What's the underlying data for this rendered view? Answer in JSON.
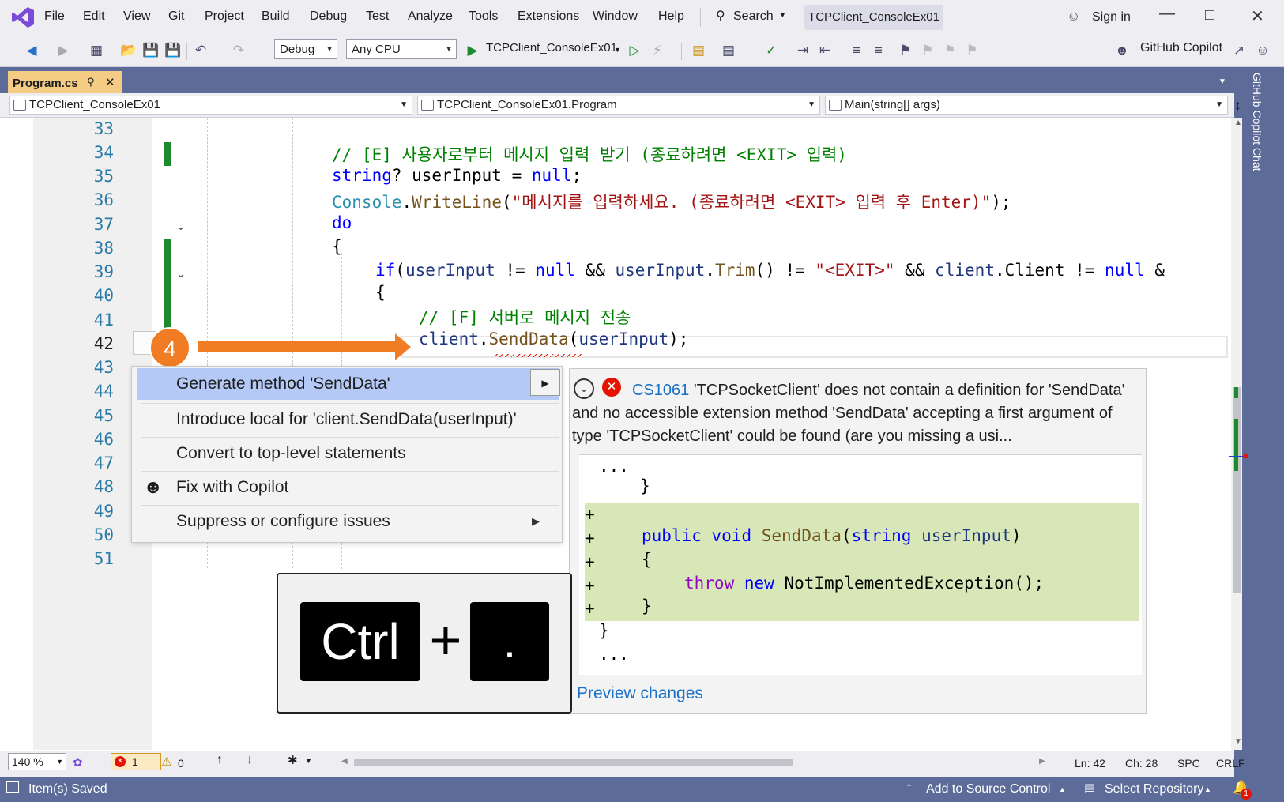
{
  "menubar": {
    "items": [
      "File",
      "Edit",
      "View",
      "Git",
      "Project",
      "Build",
      "Debug",
      "Test",
      "Analyze",
      "Tools",
      "Extensions",
      "Window",
      "Help"
    ],
    "search_label": "Search",
    "solution_title": "TCPClient_ConsoleEx01",
    "sign_in": "Sign in"
  },
  "toolbar": {
    "config": "Debug",
    "platform": "Any CPU",
    "run_target": "TCPClient_ConsoleEx01",
    "copilot_label": "GitHub Copilot"
  },
  "tabs": {
    "active_tab": "Program.cs"
  },
  "navbar": {
    "project": "TCPClient_ConsoleEx01",
    "type": "TCPClient_ConsoleEx01.Program",
    "member": "Main(string[] args)"
  },
  "side_panel": {
    "label": "GitHub Copilot Chat"
  },
  "editor": {
    "line_numbers": [
      "33",
      "34",
      "35",
      "36",
      "37",
      "38",
      "39",
      "40",
      "41",
      "42",
      "43",
      "44",
      "45",
      "46",
      "47",
      "48",
      "49",
      "50",
      "51"
    ],
    "code": {
      "l34_comment": "// [E] 사용자로부터 메시지 입력 받기 (종료하려면 <EXIT> 입력)",
      "l35_kw": "string",
      "l35_rest": "? userInput = ",
      "l35_null": "null",
      "l35_end": ";",
      "l36_type": "Console",
      "l36_dot": ".",
      "l36_fn": "WriteLine",
      "l36_open": "(",
      "l36_str": "\"메시지를 입력하세요. (종료하려면 <EXIT> 입력 후 Enter)\"",
      "l36_close": ");",
      "l37_kw": "do",
      "l38_brace": "{",
      "l39_if": "if",
      "l39_a": "(",
      "l39_v1": "userInput",
      "l39_b": " != ",
      "l39_null": "null",
      "l39_c": " && ",
      "l39_v2": "userInput",
      "l39_d": ".",
      "l39_fn": "Trim",
      "l39_e": "() != ",
      "l39_str": "\"<EXIT>\"",
      "l39_f": " && ",
      "l39_v3": "client",
      "l39_g": ".Client != ",
      "l39_null2": "null",
      "l39_h": " &",
      "l40_brace": "{",
      "l41_comment": "// [F] 서버로 메시지 전송",
      "l42_v": "client",
      "l42_dot": ".",
      "l42_fn": "SendData",
      "l42_open": "(",
      "l42_arg": "userInput",
      "l42_close": ");"
    }
  },
  "annotation": {
    "step_number": "4"
  },
  "quick_actions": {
    "items": [
      "Generate method 'SendData'",
      "Introduce local for 'client.SendData(userInput)'",
      "Convert to top-level statements",
      "Fix with Copilot",
      "Suppress or configure issues"
    ]
  },
  "preview": {
    "error_code": "CS1061",
    "error_message": "'TCPSocketClient' does not contain a definition for 'SendData' and no accessible extension method 'SendData' accepting a first argument of type 'TCPSocketClient' could be found (are you missing a usi...",
    "diff": {
      "ellipsis_top": "...",
      "close_brace_1": "}",
      "plus": "+",
      "sig_public": "public",
      "sig_void": "void",
      "sig_name": "SendData",
      "sig_open": "(",
      "sig_string": "string",
      "sig_param": "userInput",
      "sig_close": ")",
      "open_brace": "{",
      "throw_kw": "throw",
      "new_kw": "new",
      "throw_rest": "NotImplementedException();",
      "close_brace_2": "}",
      "close_brace_3": "}",
      "ellipsis_bottom": "..."
    },
    "link": "Preview changes"
  },
  "keycap": {
    "key1": "Ctrl",
    "plus": "+",
    "key2": "."
  },
  "editor_status": {
    "zoom": "140 %",
    "errors": "1",
    "warnings": "0",
    "line": "Ln: 42",
    "col": "Ch: 28",
    "indent": "SPC",
    "eol": "CRLF"
  },
  "statusbar": {
    "message": "Item(s) Saved",
    "source_control": "Add to Source Control",
    "repository": "Select Repository",
    "notifications": "1"
  },
  "colors": {
    "accent_frame": "#5d6b99",
    "active_tab": "#f5cc84",
    "annotation_orange": "#f07c24",
    "selection_blue": "#b5c9f7",
    "diff_added": "#d8e7b8"
  }
}
